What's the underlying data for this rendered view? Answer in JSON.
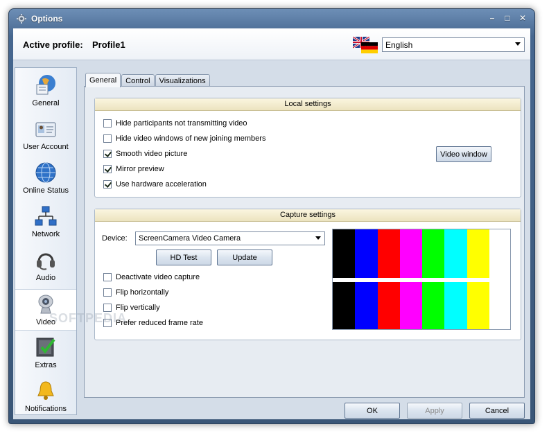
{
  "window": {
    "title": "Options"
  },
  "profile": {
    "label": "Active profile:",
    "name": "Profile1"
  },
  "language": {
    "selected": "English"
  },
  "sidebar": {
    "items": [
      {
        "label": "General",
        "icon": "globe-document-icon"
      },
      {
        "label": "User Account",
        "icon": "id-card-icon"
      },
      {
        "label": "Online Status",
        "icon": "globe-icon"
      },
      {
        "label": "Network",
        "icon": "network-icon"
      },
      {
        "label": "Audio",
        "icon": "headset-icon"
      },
      {
        "label": "Video",
        "icon": "webcam-icon"
      },
      {
        "label": "Extras",
        "icon": "checklist-icon"
      },
      {
        "label": "Notifications",
        "icon": "bell-icon"
      }
    ],
    "selected": "Video"
  },
  "tabs": [
    {
      "label": "General",
      "active": true
    },
    {
      "label": "Control",
      "active": false
    },
    {
      "label": "Visualizations",
      "active": false
    }
  ],
  "local_settings": {
    "header": "Local settings",
    "options": [
      {
        "label": "Hide participants not transmitting video",
        "checked": false
      },
      {
        "label": "Hide video windows of new joining members",
        "checked": false
      },
      {
        "label": "Smooth video picture",
        "checked": true
      },
      {
        "label": "Mirror preview",
        "checked": true
      },
      {
        "label": "Use hardware acceleration",
        "checked": true
      }
    ],
    "video_window_button": "Video window"
  },
  "capture_settings": {
    "header": "Capture settings",
    "device_label": "Device:",
    "device_selected": "ScreenCamera Video Camera",
    "hd_test_button": "HD Test",
    "update_button": "Update",
    "options": [
      {
        "label": "Deactivate video capture",
        "checked": false
      },
      {
        "label": "Flip horizontally",
        "checked": false
      },
      {
        "label": "Flip vertically",
        "checked": false
      },
      {
        "label": "Prefer reduced frame rate",
        "checked": false
      }
    ],
    "preview_colors": [
      "#000000",
      "#0000ff",
      "#ff0000",
      "#ff00ff",
      "#00ff00",
      "#00ffff",
      "#ffff00",
      "#ffffff"
    ]
  },
  "footer": {
    "ok": "OK",
    "apply": "Apply",
    "cancel": "Cancel"
  },
  "watermark": "SOFTPEDIA"
}
